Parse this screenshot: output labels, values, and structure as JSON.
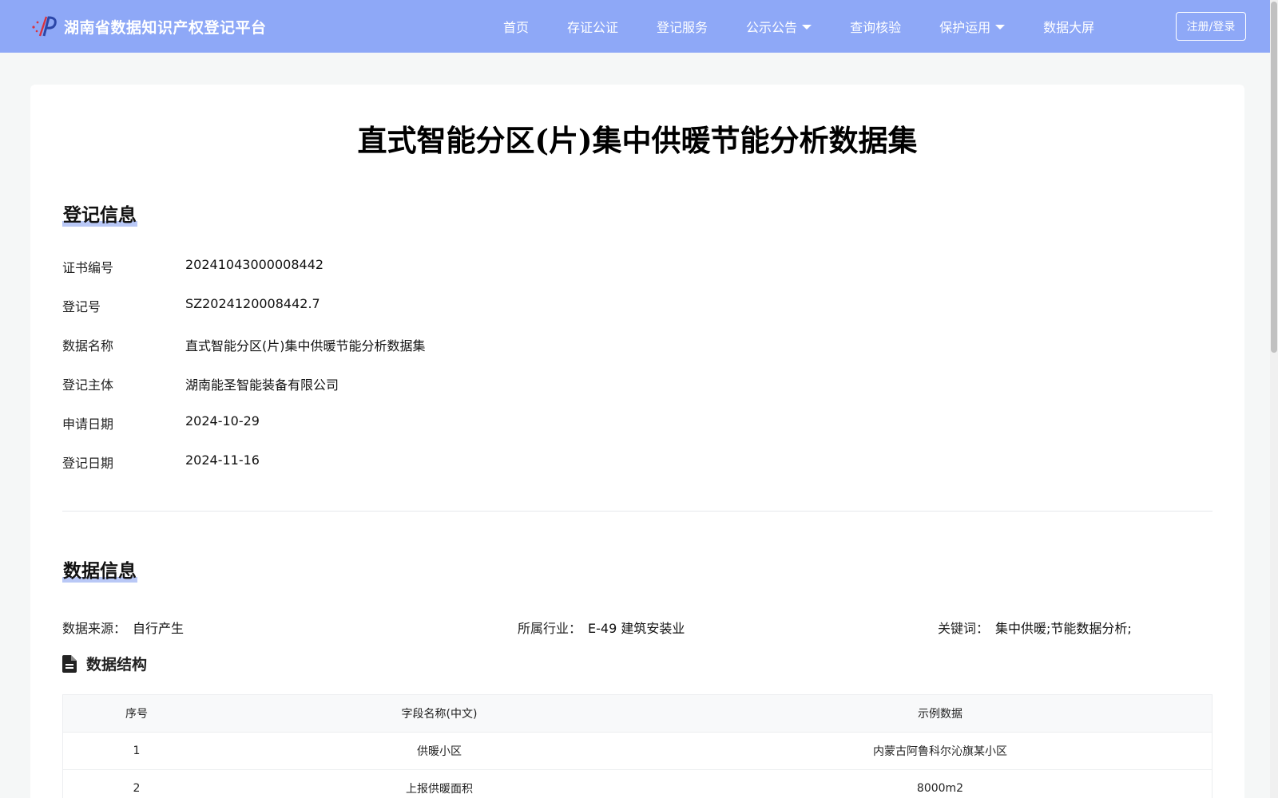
{
  "header": {
    "site_title": "湖南省数据知识产权登记平台",
    "logo_icon": "platform-logo-icon",
    "nav": [
      {
        "label": "首页",
        "has_caret": false
      },
      {
        "label": "存证公证",
        "has_caret": false
      },
      {
        "label": "登记服务",
        "has_caret": false
      },
      {
        "label": "公示公告",
        "has_caret": true
      },
      {
        "label": "查询核验",
        "has_caret": false
      },
      {
        "label": "保护运用",
        "has_caret": true
      },
      {
        "label": "数据大屏",
        "has_caret": false
      }
    ],
    "login_label": "注册/登录",
    "bar_color": "#8ea8f7"
  },
  "page_title": "直式智能分区(片)集中供暖节能分析数据集",
  "registration": {
    "heading": "登记信息",
    "rows": [
      {
        "label": "证书编号",
        "value": "20241043000008442"
      },
      {
        "label": "登记号",
        "value": "SZ2024120008442.7"
      },
      {
        "label": "数据名称",
        "value": "直式智能分区(片)集中供暖节能分析数据集"
      },
      {
        "label": "登记主体",
        "value": "湖南能圣智能装备有限公司"
      },
      {
        "label": "申请日期",
        "value": "2024-10-29"
      },
      {
        "label": "登记日期",
        "value": "2024-11-16"
      }
    ]
  },
  "data_info": {
    "heading": "数据信息",
    "source": {
      "label": "数据来源：",
      "value": "自行产生"
    },
    "industry": {
      "label": "所属行业：",
      "value": "E-49 建筑安装业"
    },
    "keywords": {
      "label": "关键词：",
      "value": "集中供暖;节能数据分析;"
    },
    "structure_heading": "数据结构",
    "structure_icon": "document-icon",
    "table": {
      "columns": [
        "序号",
        "字段名称(中文)",
        "示例数据"
      ],
      "rows": [
        [
          "1",
          "供暖小区",
          "内蒙古阿鲁科尔沁旗某小区"
        ],
        [
          "2",
          "上报供暖面积",
          "8000m2"
        ]
      ]
    }
  }
}
